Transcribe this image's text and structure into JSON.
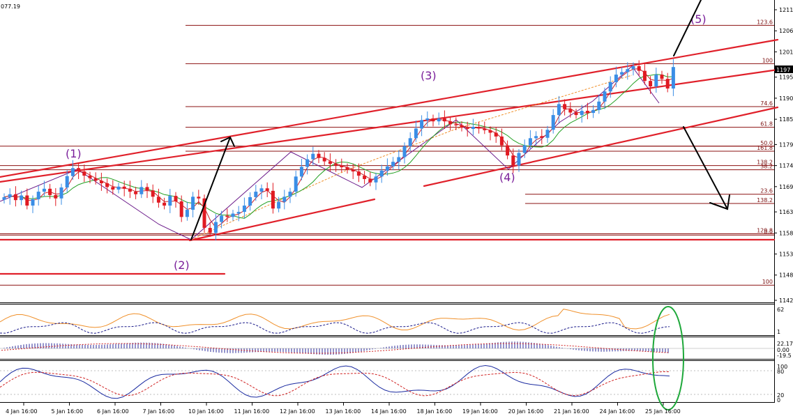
{
  "chart_data": {
    "type": "candlestick",
    "header_value": "077.19",
    "colors": {
      "bull": "#3a8ee6",
      "bear": "#e01a22",
      "trend": "#e0202a",
      "fib": "#8b1010",
      "ma_green": "#22a022",
      "wave": "#7a1f9a",
      "circle": "#1ea83a",
      "arrow": "#000000"
    },
    "price_axis": {
      "ticks": [
        1211,
        1206,
        1201,
        1195,
        1190,
        1185,
        1179,
        1174,
        1169,
        1163,
        1158,
        1153,
        1148,
        1142
      ],
      "current": "1197",
      "ylim": [
        1141,
        1213
      ]
    },
    "time_labels": [
      "4 Jan 16:00",
      "5 Jan 16:00",
      "6 Jan 16:00",
      "7 Jan 16:00",
      "10 Jan 16:00",
      "11 Jan 16:00",
      "12 Jan 16:00",
      "13 Jan 16:00",
      "14 Jan 16:00",
      "18 Jan 16:00",
      "19 Jan 16:00",
      "20 Jan 16:00",
      "21 Jan 16:00",
      "24 Jan 16:00",
      "25 Jan 16:00"
    ],
    "fib_levels": [
      {
        "label": "123.6",
        "price": 1207.3
      },
      {
        "label": "100",
        "price": 1198.2
      },
      {
        "label": "74.6",
        "price": 1188.0
      },
      {
        "label": "61.8",
        "price": 1183.1
      },
      {
        "label": "50.0",
        "price": 1178.6
      },
      {
        "label": "161.8",
        "price": 1177.4
      },
      {
        "label": "138.2",
        "price": 1174.0
      },
      {
        "label": "38.2",
        "price": 1173.0
      },
      {
        "label": "23.6",
        "price": 1167.2
      },
      {
        "label": "138.2",
        "price": 1165.0
      },
      {
        "label": "129.8",
        "price": 1157.8
      },
      {
        "label": "0.0",
        "price": 1157.5
      },
      {
        "label": "100",
        "price": 1145.6
      }
    ],
    "wave_labels": [
      "(1)",
      "(2)",
      "(3)",
      "(4)",
      "(5)"
    ],
    "close": [
      1166.5,
      1167.2,
      1165.8,
      1166.9,
      1164.5,
      1166.0,
      1167.8,
      1168.5,
      1167.0,
      1166.2,
      1168.8,
      1171.5,
      1173.4,
      1172.6,
      1171.6,
      1171.0,
      1170.4,
      1169.8,
      1168.9,
      1168.3,
      1169.0,
      1168.5,
      1167.8,
      1167.2,
      1168.9,
      1168.1,
      1166.6,
      1165.2,
      1164.5,
      1166.8,
      1165.5,
      1161.8,
      1163.5,
      1166.6,
      1166.2,
      1159.2,
      1158.0,
      1160.6,
      1162.1,
      1161.8,
      1162.6,
      1163.0,
      1164.5,
      1166.5,
      1167.8,
      1168.6,
      1168.0,
      1163.8,
      1165.4,
      1166.6,
      1167.8,
      1171.4,
      1173.7,
      1175.5,
      1176.8,
      1175.8,
      1175.0,
      1174.4,
      1174.0,
      1173.6,
      1173.0,
      1172.6,
      1171.6,
      1170.8,
      1170.0,
      1171.4,
      1172.8,
      1173.8,
      1174.9,
      1176.0,
      1178.6,
      1180.5,
      1182.8,
      1184.8,
      1185.2,
      1184.5,
      1185.2,
      1184.5,
      1183.8,
      1183.6,
      1183.0,
      1182.7,
      1183.2,
      1182.8,
      1182.4,
      1181.8,
      1180.9,
      1178.8,
      1176.4,
      1174.0,
      1177.0,
      1178.8,
      1180.5,
      1181.0,
      1180.6,
      1182.5,
      1186.0,
      1188.6,
      1187.4,
      1186.6,
      1186.0,
      1187.0,
      1186.5,
      1187.2,
      1189.2,
      1191.6,
      1193.8,
      1195.6,
      1196.2,
      1196.9,
      1197.6,
      1196.5,
      1194.1,
      1192.8,
      1195.6,
      1194.6,
      1192.3,
      1197.4
    ]
  }
}
